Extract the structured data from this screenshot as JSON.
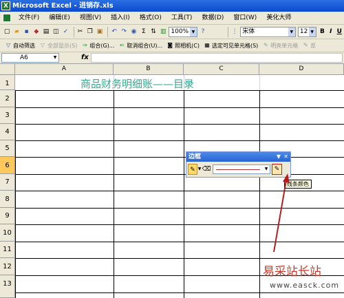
{
  "window": {
    "title": "Microsoft Excel - 进销存.xls",
    "logo": "X"
  },
  "menu": [
    "文件(F)",
    "编辑(E)",
    "视图(V)",
    "插入(I)",
    "格式(O)",
    "工具(T)",
    "数据(D)",
    "窗口(W)",
    "美化大师"
  ],
  "toolbar": {
    "zoom": "100%",
    "font_name": "宋体",
    "font_size": "12",
    "bold": "B",
    "italic": "I",
    "underline": "U",
    "sum": "Σ",
    "help": "?"
  },
  "toolbar2": {
    "items": [
      {
        "icon": "filter-icon",
        "label": "自动筛选",
        "dim": false
      },
      {
        "icon": "show-all-icon",
        "label": "全部显示(S)",
        "dim": true
      },
      {
        "icon": "group-icon",
        "label": "组合(G)...",
        "dim": false
      },
      {
        "icon": "ungroup-icon",
        "label": "取消组合(U)...",
        "dim": false
      },
      {
        "icon": "camera-icon",
        "label": "照相机(C)",
        "dim": false
      },
      {
        "icon": "select-visible-icon",
        "label": "选定可见单元格(S)",
        "dim": false
      },
      {
        "icon": "light-cell-icon",
        "label": "明亮单元格",
        "dim": true
      },
      {
        "icon": "reverse-icon",
        "label": "反",
        "dim": true
      }
    ]
  },
  "formula_bar": {
    "name_box": "A6",
    "fx": "fx",
    "formula": ""
  },
  "columns": [
    "A",
    "B",
    "C",
    "D"
  ],
  "rows": [
    "1",
    "2",
    "3",
    "4",
    "5",
    "6",
    "7",
    "8",
    "9",
    "10",
    "11",
    "12",
    "13"
  ],
  "selected_row": "6",
  "sheet": {
    "title": "商品财务明细账——目录",
    "title_color": "#3ba58d"
  },
  "border_toolbar": {
    "title": "边框",
    "tooltip": "线条颜色",
    "pen_color": "#cc1a1a"
  },
  "watermark": {
    "text": "易采站长站",
    "url": "www.easck.com"
  }
}
